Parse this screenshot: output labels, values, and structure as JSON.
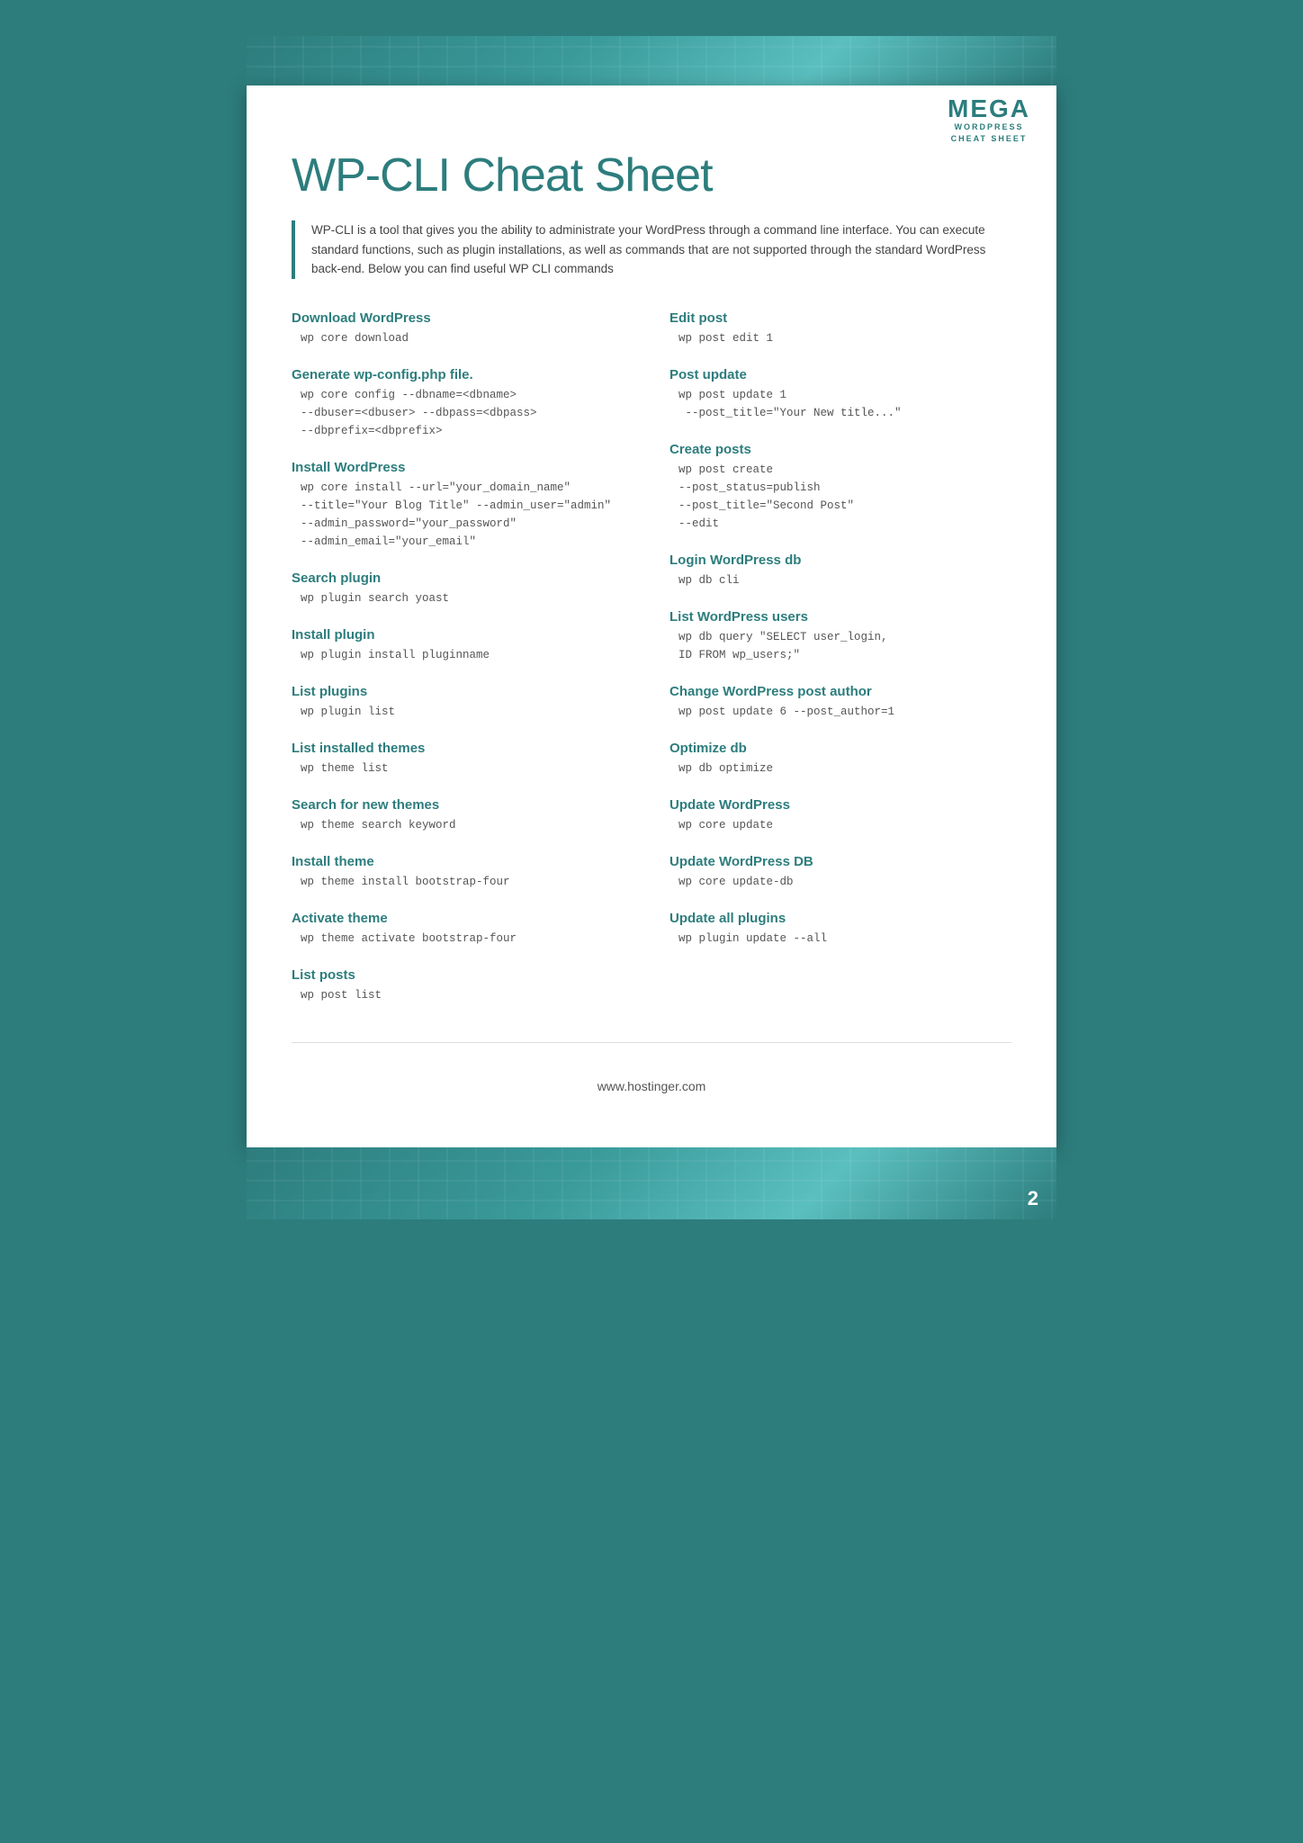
{
  "logo": {
    "mega": "MEGA",
    "line1": "WORDPRESS",
    "line2": "CHEAT SHEET"
  },
  "header": {
    "title": "WP-CLI Cheat Sheet"
  },
  "intro": {
    "text": "WP-CLI is a tool that gives you the ability to administrate your WordPress through a command line interface. You can execute standard functions, such as plugin installations, as well as commands that are not supported through the standard WordPress back-end. Below you can find useful WP CLI commands"
  },
  "left_sections": [
    {
      "title": "Download WordPress",
      "code": "wp core download"
    },
    {
      "title": "Generate wp-config.php file.",
      "code": "wp core config --dbname=<dbname>\n--dbuser=<dbuser> --dbpass=<dbpass>\n--dbprefix=<dbprefix>"
    },
    {
      "title": "Install WordPress",
      "code": "wp core install --url=\"your_domain_name\"\n--title=\"Your Blog Title\" --admin_user=\"admin\"\n--admin_password=\"your_password\"\n--admin_email=\"your_email\""
    },
    {
      "title": "Search plugin",
      "code": "wp plugin search yoast"
    },
    {
      "title": "Install plugin",
      "code": "wp plugin install pluginname"
    },
    {
      "title": "List plugins",
      "code": "wp plugin list"
    },
    {
      "title": "List installed themes",
      "code": "wp theme list"
    },
    {
      "title": "Search for new themes",
      "code": "wp theme search keyword"
    },
    {
      "title": "Install theme",
      "code": "wp theme install bootstrap-four"
    },
    {
      "title": "Activate theme",
      "code": "wp theme activate bootstrap-four"
    },
    {
      "title": "List posts",
      "code": "wp post list"
    }
  ],
  "right_sections": [
    {
      "title": "Edit post",
      "code": "wp post edit 1"
    },
    {
      "title": "Post update",
      "code": "wp post update 1\n --post_title=\"Your New title...\""
    },
    {
      "title": "Create posts",
      "code": "wp post create\n--post_status=publish\n--post_title=\"Second Post\"\n--edit"
    },
    {
      "title": "Login WordPress db",
      "code": "wp db cli"
    },
    {
      "title": "List WordPress users",
      "code": "wp db query \"SELECT user_login,\nID FROM wp_users;\""
    },
    {
      "title": "Change WordPress post author",
      "code": "wp post update 6 --post_author=1"
    },
    {
      "title": "Optimize db",
      "code": "wp db optimize"
    },
    {
      "title": "Update WordPress",
      "code": "wp core update"
    },
    {
      "title": "Update WordPress DB",
      "code": "wp core update-db"
    },
    {
      "title": "Update all plugins",
      "code": "wp plugin update --all"
    }
  ],
  "footer": {
    "url": "www.hostinger.com"
  },
  "page_number": "2"
}
